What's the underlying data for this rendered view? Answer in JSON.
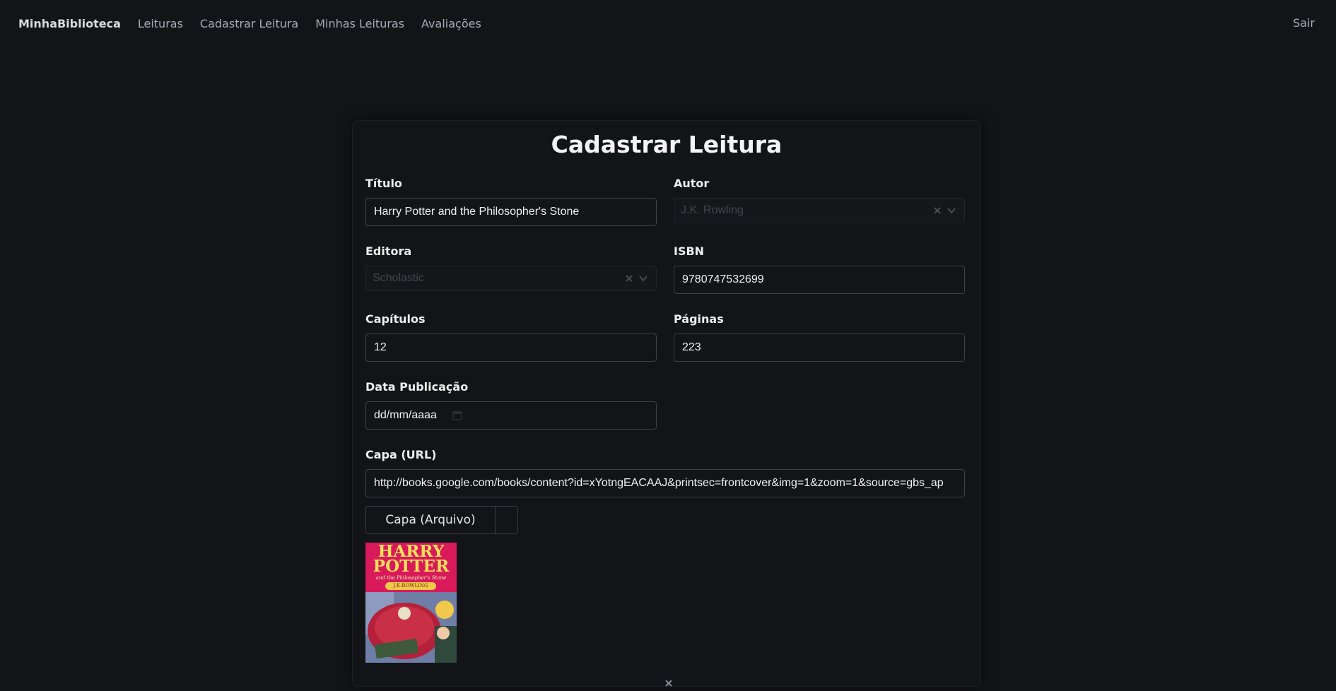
{
  "nav": {
    "brand": "MinhaBiblioteca",
    "links": [
      "Leituras",
      "Cadastrar Leitura",
      "Minhas Leituras",
      "Avaliações"
    ],
    "logout": "Sair"
  },
  "form": {
    "title": "Cadastrar Leitura",
    "titulo": {
      "label": "Título",
      "value": "Harry Potter and the Philosopher's Stone"
    },
    "autor": {
      "label": "Autor",
      "value": "J.K. Rowling"
    },
    "editora": {
      "label": "Editora",
      "value": "Scholastic"
    },
    "isbn": {
      "label": "ISBN",
      "value": "9780747532699"
    },
    "capitulos": {
      "label": "Capítulos",
      "value": "12"
    },
    "paginas": {
      "label": "Páginas",
      "value": "223"
    },
    "data_publicacao": {
      "label": "Data Publicação",
      "value": "dd/mm/aaaa"
    },
    "capa_url": {
      "label": "Capa (URL)",
      "value": "http://books.google.com/books/content?id=xYotngEACAAJ&printsec=frontcover&img=1&zoom=1&source=gbs_ap"
    },
    "capa_arquivo": {
      "label": "Capa (Arquivo)"
    },
    "cover": {
      "title": "HARRY POTTER",
      "subtitle": "and the Philosopher's Stone",
      "author": "J.K.ROWLING"
    }
  },
  "colors": {
    "background": "#131418",
    "cover_bg": "#d81a5b",
    "cover_title": "#f7e15a"
  }
}
